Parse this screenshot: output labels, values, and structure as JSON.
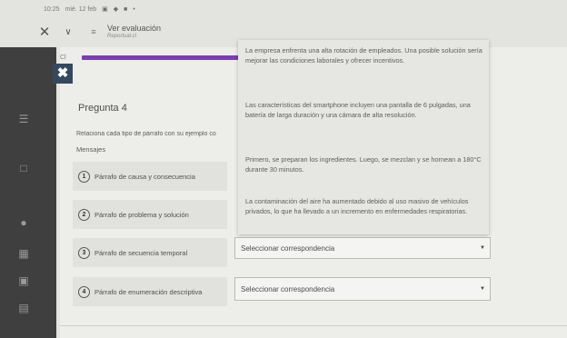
{
  "status_bar": {
    "time": "10:25",
    "date": "mié. 12 feb",
    "icons": "▣ ◆ ■ •"
  },
  "top_bar": {
    "close_glyph": "✕",
    "chevron_glyph": "∨",
    "tabs_glyph": "≡",
    "page_title": "Ver evaluación",
    "page_url": "Reportual.cl"
  },
  "rail": {
    "close_glyph": "✖",
    "small_label": "Cl"
  },
  "question": {
    "title": "Pregunta 4",
    "instructions": "Relaciona cada tipo de párrafo con su ejemplo co",
    "messages_label": "Mensajes"
  },
  "items": [
    {
      "number": "1",
      "label": "Párrafo de causa y consecuencia"
    },
    {
      "number": "2",
      "label": "Párrafo de problema y solución"
    },
    {
      "number": "3",
      "label": "Párrafo de secuencia temporal"
    },
    {
      "number": "4",
      "label": "Párrafo de enumeración descriptiva"
    }
  ],
  "options": [
    {
      "text": "La empresa enfrenta una alta rotación de empleados. Una posible solución sería mejorar las condiciones laborales y ofrecer incentivos."
    },
    {
      "text": "Las características del smartphone incluyen una pantalla de 6 pulgadas, una batería de larga duración y una cámara de alta resolución."
    },
    {
      "text": "Primero, se preparan los ingredientes. Luego, se mezclan y se hornean a 180°C durante 30 minutos."
    },
    {
      "text": "La contaminación del aire ha aumentado debido al uso masivo de vehículos privados, lo que ha llevado a un incremento en enfermedades respiratorias."
    }
  ],
  "selects": [
    {
      "value": "Seleccionar correspondencia"
    },
    {
      "value": "Seleccionar correspondencia"
    }
  ],
  "caret_glyph": "▼",
  "colors": {
    "accent_progress": "#7b3fb0",
    "rail": "#3f3f3f",
    "close_button": "#34495e"
  }
}
